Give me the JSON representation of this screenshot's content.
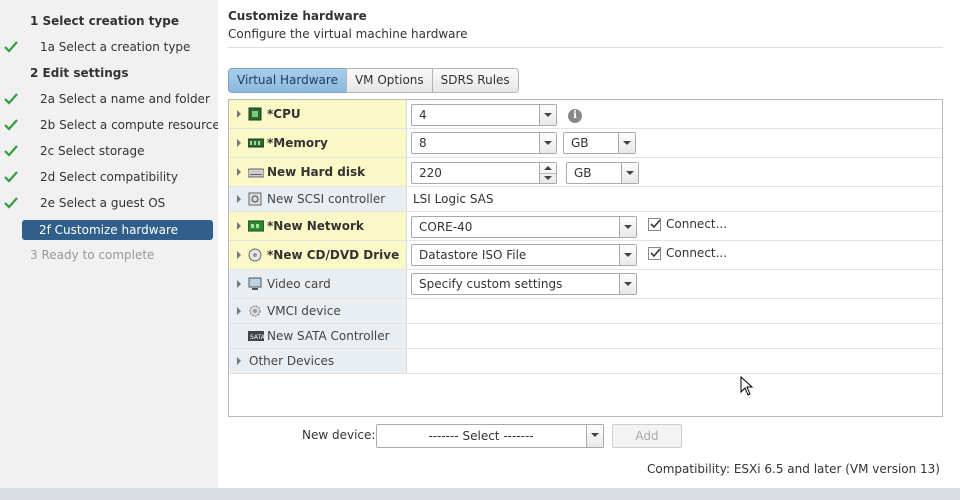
{
  "sidebar": {
    "steps": [
      {
        "label": "1   Select creation type",
        "type": "header"
      },
      {
        "label": "1a  Select a creation type",
        "type": "sub",
        "done": true
      },
      {
        "label": "2   Edit settings",
        "type": "header"
      },
      {
        "label": "2a  Select a name and folder",
        "type": "sub",
        "done": true
      },
      {
        "label": "2b  Select a compute resource",
        "type": "sub",
        "done": true
      },
      {
        "label": "2c  Select storage",
        "type": "sub",
        "done": true
      },
      {
        "label": "2d  Select compatibility",
        "type": "sub",
        "done": true
      },
      {
        "label": "2e  Select a guest OS",
        "type": "sub",
        "done": true
      },
      {
        "label": "2f  Customize hardware",
        "type": "active"
      },
      {
        "label": "3   Ready to complete",
        "type": "disabled"
      }
    ]
  },
  "main": {
    "title": "Customize hardware",
    "subtitle": "Configure the virtual machine hardware",
    "tabs": [
      {
        "label": "Virtual Hardware",
        "active": true
      },
      {
        "label": "VM Options",
        "active": false
      },
      {
        "label": "SDRS Rules",
        "active": false
      }
    ]
  },
  "hardware": {
    "cpu": {
      "name": "*CPU",
      "icon": "cpu-icon",
      "value": "4"
    },
    "memory": {
      "name": "*Memory",
      "icon": "memory-icon",
      "value": "8",
      "unit": "GB"
    },
    "disk": {
      "name": "New Hard disk",
      "icon": "hard-disk-icon",
      "value": "220",
      "unit": "GB"
    },
    "scsi": {
      "name": "New SCSI controller",
      "icon": "scsi-controller-icon",
      "value": "LSI Logic SAS"
    },
    "network": {
      "name": "*New Network",
      "icon": "network-icon",
      "value": "CORE-40",
      "connect_label": "Connect...",
      "connected": true
    },
    "cd": {
      "name": "*New CD/DVD Drive",
      "icon": "cd-dvd-icon",
      "value": "Datastore ISO File",
      "connect_label": "Connect...",
      "connected": true
    },
    "video": {
      "name": "Video card",
      "icon": "video-card-icon",
      "value": "Specify custom settings"
    },
    "vmci": {
      "name": "VMCI device",
      "icon": "vmci-device-icon"
    },
    "sata": {
      "name": "New SATA Controller",
      "icon": "sata-controller-icon"
    },
    "other": {
      "name": "Other Devices"
    }
  },
  "footer": {
    "new_device_label": "New device:",
    "new_device_value": "------- Select -------",
    "add_label": "Add",
    "compatibility": "Compatibility: ESXi 6.5 and later (VM version 13)"
  },
  "colors": {
    "active_step_bg": "#2f5f8a",
    "highlight_row_bg": "#fbf8c7",
    "label_cell_bg": "#e8eef2",
    "checkmark": "#2e9e3e"
  }
}
